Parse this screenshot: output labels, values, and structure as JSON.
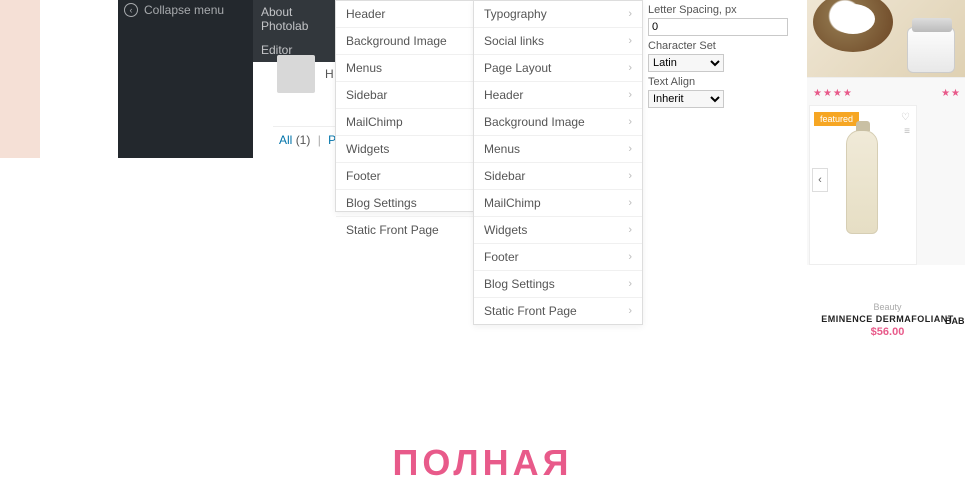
{
  "wp": {
    "collapse_label": "Collapse menu",
    "submenu": [
      "About Photolab",
      "Editor"
    ],
    "author_placeholder": "H\nin",
    "filters": {
      "all": "All",
      "all_count": "(1)",
      "sep": "|",
      "pending": "Per"
    }
  },
  "panelA": [
    "Header",
    "Background Image",
    "Menus",
    "Sidebar",
    "MailChimp",
    "Widgets",
    "Footer",
    "Blog Settings",
    "Static Front Page"
  ],
  "panelB": [
    "Typography",
    "Social links",
    "Page Layout",
    "Header",
    "Background Image",
    "Menus",
    "Sidebar",
    "MailChimp",
    "Widgets",
    "Footer",
    "Blog Settings",
    "Static Front Page"
  ],
  "settings": {
    "letter_spacing_label": "Letter Spacing, px",
    "letter_spacing_value": "0",
    "charset_label": "Character Set",
    "charset_value": "Latin",
    "align_label": "Text Align",
    "align_value": "Inherit"
  },
  "preview": {
    "stars_left": "★★★★",
    "stars_right": "★★",
    "badge": "featured",
    "nav_arrow": "‹",
    "heart": "♡",
    "bars": "≡",
    "category": "Beauty",
    "product_name": "EMINENCE DERMAFOLIANT",
    "price": "$56.00",
    "product_name_2": "BAB"
  },
  "headline": "ПОЛНАЯ"
}
